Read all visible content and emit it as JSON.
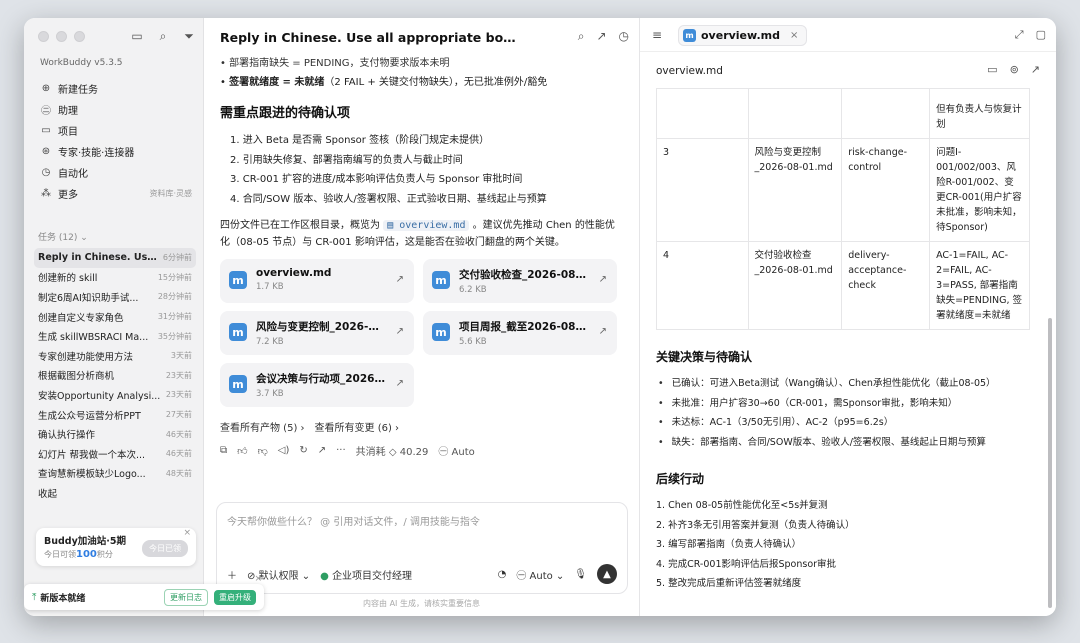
{
  "sidebar": {
    "brand": "WorkBuddy",
    "version": "v5.3.5",
    "nav": [
      {
        "icon": "plus-circle-icon",
        "glyph": "⊕",
        "label": "新建任务",
        "hint": ""
      },
      {
        "icon": "assistant-icon",
        "glyph": "㊁",
        "label": "助理",
        "hint": ""
      },
      {
        "icon": "folder-icon",
        "glyph": "▭",
        "label": "项目",
        "hint": ""
      },
      {
        "icon": "skill-icon",
        "glyph": "⊛",
        "label": "专家·技能·连接器",
        "hint": ""
      },
      {
        "icon": "automation-icon",
        "glyph": "◷",
        "label": "自动化",
        "hint": ""
      },
      {
        "icon": "more-icon",
        "glyph": "⁂",
        "label": "更多",
        "hint": "资料库·灵感"
      }
    ],
    "tasks_header": "任务 (12) ⌄",
    "tasks": [
      {
        "title": "Reply in Chinese. Use ...",
        "time": "6分钟前"
      },
      {
        "title": "创建新的 skill",
        "time": "15分钟前"
      },
      {
        "title": "制定6周AI知识助手试...",
        "time": "28分钟前"
      },
      {
        "title": "创建自定义专家角色",
        "time": "31分钟前"
      },
      {
        "title": "生成 skillWBSRACI Ma...",
        "time": "35分钟前"
      },
      {
        "title": "专家创建功能使用方法",
        "time": "3天前"
      },
      {
        "title": "根据截图分析商机",
        "time": "23天前"
      },
      {
        "title": "安装Opportunity Analysi...",
        "time": "23天前"
      },
      {
        "title": "生成公众号运营分析PPT",
        "time": "27天前"
      },
      {
        "title": "确认执行操作",
        "time": "46天前"
      },
      {
        "title": "幻灯片 帮我做一个本次...",
        "time": "46天前"
      },
      {
        "title": "查询慧新模板缺少Logo...",
        "time": "48天前"
      },
      {
        "title": "收起",
        "time": ""
      }
    ],
    "promo": {
      "title": "Buddy加油站·5期",
      "sub_prefix": "今日可领",
      "sub_value": "100",
      "sub_suffix": "积分",
      "button": "今日已领",
      "close": "×"
    },
    "update": {
      "text": "新版本就绪",
      "log_button": "更新日志",
      "restart_button": "重启升级",
      "close": "×"
    }
  },
  "chat": {
    "title": "Reply in Chinese. Use all appropriate bound projec...",
    "cut_line": "• 部署指南缺失 = PENDING，支付物要求版本未明",
    "bullet_bold": "签署就绪度 = 未就绪",
    "bullet_rest": "（2 FAIL + 关键交付物缺失），无已批准例外/豁免",
    "heading": "需重点跟进的待确认项",
    "items": [
      "1. 进入 Beta 是否需 Sponsor 签核（阶段门规定未提供）",
      "2. 引用缺失修复、部署指南编写的负责人与截止时间",
      "3. CR-001 扩容的进度/成本影响评估负责人与 Sponsor 审批时间",
      "4. 合同/SOW 版本、验收人/签署权限、正式验收日期、基线起止与预算"
    ],
    "para_pre": "四份文件已在工作区根目录，概览为",
    "para_code": "overview.md",
    "para_post": "。建议优先推动 Chen 的性能优化（08-05 节点）与 CR-001 影响评估，这是能否在验收门翻盘的两个关键。",
    "files": [
      {
        "name": "overview.md",
        "size": "1.7 KB"
      },
      {
        "name": "交付验收检查_2026-08-0...",
        "size": "6.2 KB"
      },
      {
        "name": "风险与变更控制_2026-08...",
        "size": "7.2 KB"
      },
      {
        "name": "项目周报_截至2026-08-0...",
        "size": "5.6 KB"
      },
      {
        "name": "会议决策与行动项_2026-...",
        "size": "3.7 KB"
      }
    ],
    "link_products": "查看所有产物 (5) ›",
    "link_changes": "查看所有变更 (6) ›",
    "consumption": "共消耗 ◇ 40.29",
    "model_mode": "㊀ Auto",
    "input_placeholder": "今天帮你做些什么？ @ 引用对话文件，/ 调用技能与指令",
    "permission": "默认权限 ⌄",
    "agent": "企业项目交付经理",
    "auto": "Auto ⌄",
    "footer": "内容由 AI 生成，请核实重要信息"
  },
  "preview": {
    "tab": "overview.md",
    "path": "overview.md",
    "table_top_cut": "但有负责人与恢复计划",
    "rows": [
      {
        "no": "3",
        "file": "风险与变更控制_2026-08-01.md",
        "key": "risk-change-control",
        "summary": "问题I-001/002/003、风险R-001/002、变更CR-001(用户扩容未批准，影响未知，待Sponsor)"
      },
      {
        "no": "4",
        "file": "交付验收检查_2026-08-01.md",
        "key": "delivery-acceptance-check",
        "summary": "AC-1=FAIL, AC-2=FAIL, AC-3=PASS, 部署指南缺失=PENDING, 签署就绪度=未就绪"
      }
    ],
    "section1": "关键决策与待确认",
    "bullets": [
      "已确认：可进入Beta测试（Wang确认）、Chen承担性能优化（截止08-05）",
      "未批准：用户扩容30→60（CR-001，需Sponsor审批，影响未知）",
      "未达标：AC-1（3/50无引用）、AC-2（p95=6.2s）",
      "缺失：部署指南、合同/SOW版本、验收人/签署权限、基线起止日期与预算"
    ],
    "section2": "后续行动",
    "actions": [
      "1.  Chen 08-05前性能优化至<5s并复测",
      "2.  补齐3条无引用答案并复测（负责人待确认）",
      "3.  编写部署指南（负责人待确认）",
      "4.  完成CR-001影响评估后报Sponsor审批",
      "5.  整改完成后重新评估签署就绪度"
    ]
  }
}
